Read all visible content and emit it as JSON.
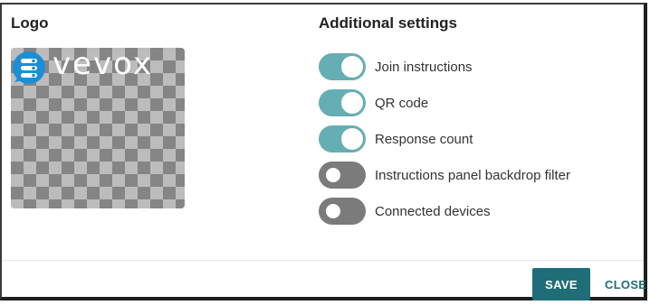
{
  "logo_section": {
    "title": "Logo",
    "logo_text": "vevox",
    "brand_color": "#1a8fd6"
  },
  "settings_section": {
    "title": "Additional settings",
    "items": [
      {
        "label": "Join instructions",
        "enabled": true
      },
      {
        "label": "QR code",
        "enabled": true
      },
      {
        "label": "Response count",
        "enabled": true
      },
      {
        "label": "Instructions panel backdrop filter",
        "enabled": false
      },
      {
        "label": "Connected devices",
        "enabled": false
      }
    ],
    "toggle_on_color": "#65aeb4",
    "toggle_off_color": "#7b7b7b"
  },
  "footer": {
    "save_label": "SAVE",
    "close_label": "CLOSE",
    "accent_color": "#1f6e77"
  }
}
